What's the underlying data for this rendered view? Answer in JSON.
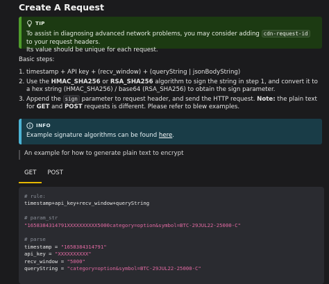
{
  "title": "Create A Request",
  "tip": {
    "label": "TIP",
    "text_before": "To assist in diagnosing advanced network problems, you may consider adding ",
    "code": "cdn-request-id",
    "text_after": " to your request headers.",
    "line2": "Its value should be unique for each request."
  },
  "basic_steps": "Basic steps:",
  "steps": {
    "s1": "timestamp + API key + (recv_window) + (queryString | jsonBodyString)",
    "s2_a": "Use the ",
    "s2_b": "HMAC_SHA256",
    "s2_c": " or ",
    "s2_d": "RSA_SHA256",
    "s2_e": " algorithm to sign the string in step 1, and convert it to a hex string (HMAC_SHA256) / base64 (RSA_SHA256) to obtain the sign parameter.",
    "s3_a": "Append the ",
    "s3_code": "sign",
    "s3_b": " parameter to request header, and send the HTTP request. ",
    "s3_note": "Note:",
    "s3_c": " the plain text for ",
    "s3_get": "GET",
    "s3_d": " and ",
    "s3_post": "POST",
    "s3_e": " requests is different. Please refer to blew examples."
  },
  "info": {
    "label": "INFO",
    "text": "Example signature algorithms can be found ",
    "link": "here",
    "end": "."
  },
  "example_note": "An example for how to generate plain text to encrypt",
  "tabs": {
    "get": "GET",
    "post": "POST"
  },
  "code": {
    "c1": "# rule:",
    "l1": "timestamp+api_key+recv_window+queryString",
    "c2": "# param_str",
    "l2": "\"1658384314791XXXXXXXXXX5000category=option&symbol=BTC-29JUL22-25000-C\"",
    "c3": "# parse",
    "l3k": "timestamp = ",
    "l3v": "\"1658384314791\"",
    "l4k": "api_key = ",
    "l4v": "\"XXXXXXXXXX\"",
    "l5k": "recv_window = ",
    "l5v": "\"5000\"",
    "l6k": "queryString = ",
    "l6v": "\"category=option&symbol=BTC-29JUL22-25000-C\""
  },
  "colors": {
    "tip_accent": "#4f9c2b",
    "info_accent": "#4cb3d4",
    "tab_accent": "#e6b800",
    "string": "#e36aa3"
  }
}
